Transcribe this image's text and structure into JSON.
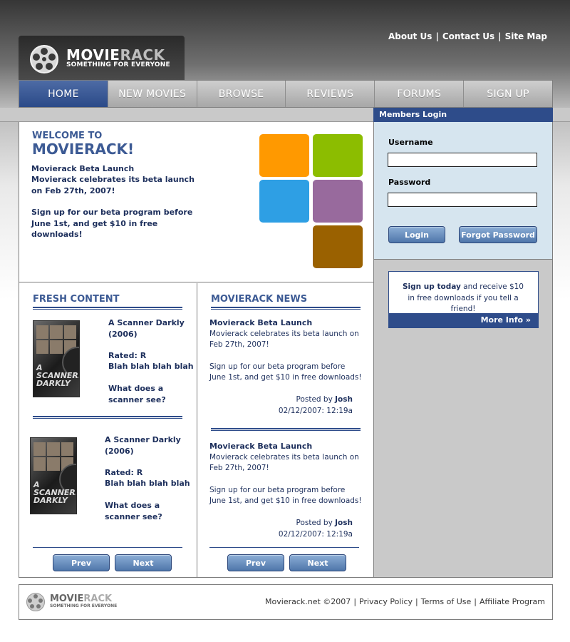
{
  "top_links": [
    "About Us",
    "Contact Us",
    "Site Map"
  ],
  "logo": {
    "title_main": "MOVIE",
    "title_accent": "RACK",
    "tagline": "SOMETHING FOR EVERYONE"
  },
  "nav": [
    "HOME",
    "NEW MOVIES",
    "BROWSE",
    "REVIEWS",
    "FORUMS",
    "SIGN UP"
  ],
  "members_login": "Members Login",
  "welcome": {
    "small": "WELCOME TO",
    "big": "MOVIERACK!",
    "heading": "Movierack Beta Launch",
    "body1": "Movierack celebrates its beta launch on Feb 27th, 2007!",
    "body2": "Sign up for our beta program before June 1st, and get $10 in free downloads!"
  },
  "colors": {
    "orange": "#ff9900",
    "green": "#8cbd00",
    "blue": "#2e9fe4",
    "purple": "#986a9d",
    "brown": "#9a6100",
    "nav_active": "#2e4c8a"
  },
  "fresh": {
    "title": "FRESH CONTENT",
    "items": [
      {
        "name": "A Scanner Darkly (2006)",
        "rated": "Rated: R",
        "desc": "Blah blah blah blah",
        "question": "What does a scanner see?",
        "cover_text": "A SCANNER DARKLY"
      },
      {
        "name": "A Scanner Darkly (2006)",
        "rated": "Rated: R",
        "desc": "Blah blah blah blah",
        "question": "What does a scanner see?",
        "cover_text": "A SCANNER DARKLY"
      }
    ],
    "prev": "Prev",
    "next": "Next"
  },
  "news": {
    "title": "MOVIERACK NEWS",
    "items": [
      {
        "title": "Movierack Beta Launch",
        "body1": "Movierack celebrates its beta launch on Feb 27th, 2007!",
        "body2": "Sign up for our beta program before June 1st, and get $10 in free downloads!",
        "posted_by": "Posted by",
        "author": "Josh",
        "date": "02/12/2007: 12:19a"
      },
      {
        "title": "Movierack Beta Launch",
        "body1": "Movierack celebrates its beta launch on Feb 27th, 2007!",
        "body2": "Sign up for our beta program before June 1st, and get $10 in free downloads!",
        "posted_by": "Posted by",
        "author": "Josh",
        "date": "02/12/2007: 12:19a"
      }
    ],
    "prev": "Prev",
    "next": "Next"
  },
  "login": {
    "username_label": "Username",
    "password_label": "Password",
    "login_button": "Login",
    "forgot_button": "Forgot Password"
  },
  "promo": {
    "bold": "Sign up today",
    "text": " and receive $10 in free downloads if you tell a friend!",
    "more": "More Info »"
  },
  "footer": {
    "copyright": "Movierack.net ©2007",
    "links": [
      "Privacy Policy",
      "Terms of Use",
      "Affiliate Program"
    ]
  }
}
